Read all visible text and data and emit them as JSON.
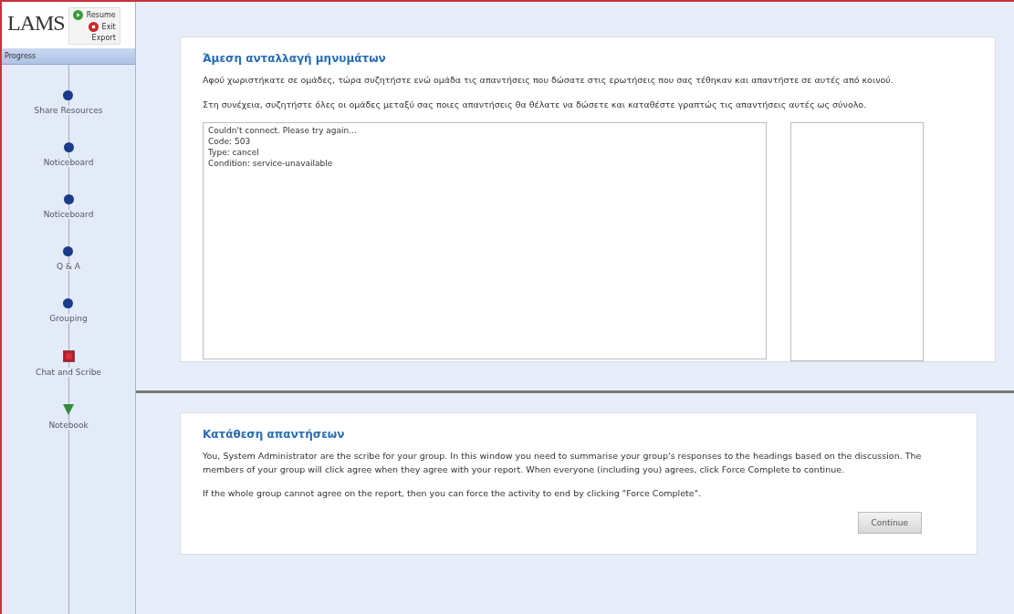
{
  "header": {
    "logo": "LAMS",
    "actions": [
      {
        "kind": "resume",
        "label": "Resume"
      },
      {
        "kind": "exit",
        "label": "Exit"
      },
      {
        "kind": "plain",
        "label": "Export"
      }
    ]
  },
  "progress": {
    "title": "Progress",
    "activities": [
      {
        "label": "Share Resources",
        "kind": "done"
      },
      {
        "label": "Noticeboard",
        "kind": "done"
      },
      {
        "label": "Noticeboard",
        "kind": "done"
      },
      {
        "label": "Q & A",
        "kind": "done"
      },
      {
        "label": "Grouping",
        "kind": "done"
      },
      {
        "label": "Chat and Scribe",
        "kind": "current"
      },
      {
        "label": "Notebook",
        "kind": "future"
      }
    ]
  },
  "chat": {
    "title": "Άμεση ανταλλαγή μηνυμάτων",
    "paragraphs": [
      "Αφού χωριστήκατε σε ομάδες, τώρα συζητήστε ενώ ομάδα τις απαντήσεις που δώσατε στις ερωτήσεις που σας τέθηκαν και απαντήστε σε αυτές από κοινού.",
      "Στη συνέχεια, συζητήστε όλες οι ομάδες μεταξύ σας ποιες απαντήσεις θα θέλατε να δώσετε και καταθέστε γραπτώς τις απαντήσεις αυτές ως σύνολο."
    ],
    "messages": [
      "Couldn't connect. Please try again...",
      "Code: 503",
      "Type: cancel",
      "Condition: service-unavailable"
    ]
  },
  "scribe": {
    "title": "Κατάθεση απαντήσεων",
    "paragraphs": [
      "You, System Administrator are the scribe for your group. In this window you need to summarise your group's responses to the headings based on the discussion. The members of your group will click agree when they agree with your report. When everyone (including you) agrees, click Force Complete to continue.",
      "If the whole group cannot agree on the report, then you can force the activity to end by clicking \"Force Complete\"."
    ],
    "button": "Continue"
  }
}
